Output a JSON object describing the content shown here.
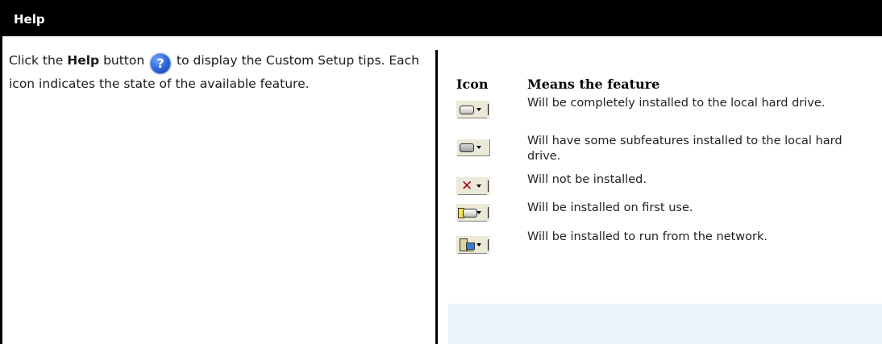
{
  "header": {
    "title": "Help"
  },
  "intro": {
    "prefix": "Click the ",
    "bold": "Help",
    "middle": " button ",
    "suffix": " to display the Custom Setup tips. Each icon indicates the state of the available feature.",
    "icon": "help-question-icon"
  },
  "legend": {
    "col_icon": "Icon",
    "col_meaning": "Means the feature",
    "rows": [
      {
        "icon": "hard-drive-full-icon",
        "text": "Will be completely installed to the local hard drive."
      },
      {
        "icon": "hard-drive-partial-icon",
        "text": "Will have some subfeatures installed to the local hard drive."
      },
      {
        "icon": "not-installed-x-icon",
        "text": "Will not be installed."
      },
      {
        "icon": "install-on-first-use-icon",
        "text": "Will be installed on first use."
      },
      {
        "icon": "run-from-network-icon",
        "text": "Will be installed to run from the network."
      }
    ]
  },
  "colors": {
    "header_bg": "#000000",
    "panel_bg": "#eaf2fa",
    "x_red": "#b00018"
  }
}
